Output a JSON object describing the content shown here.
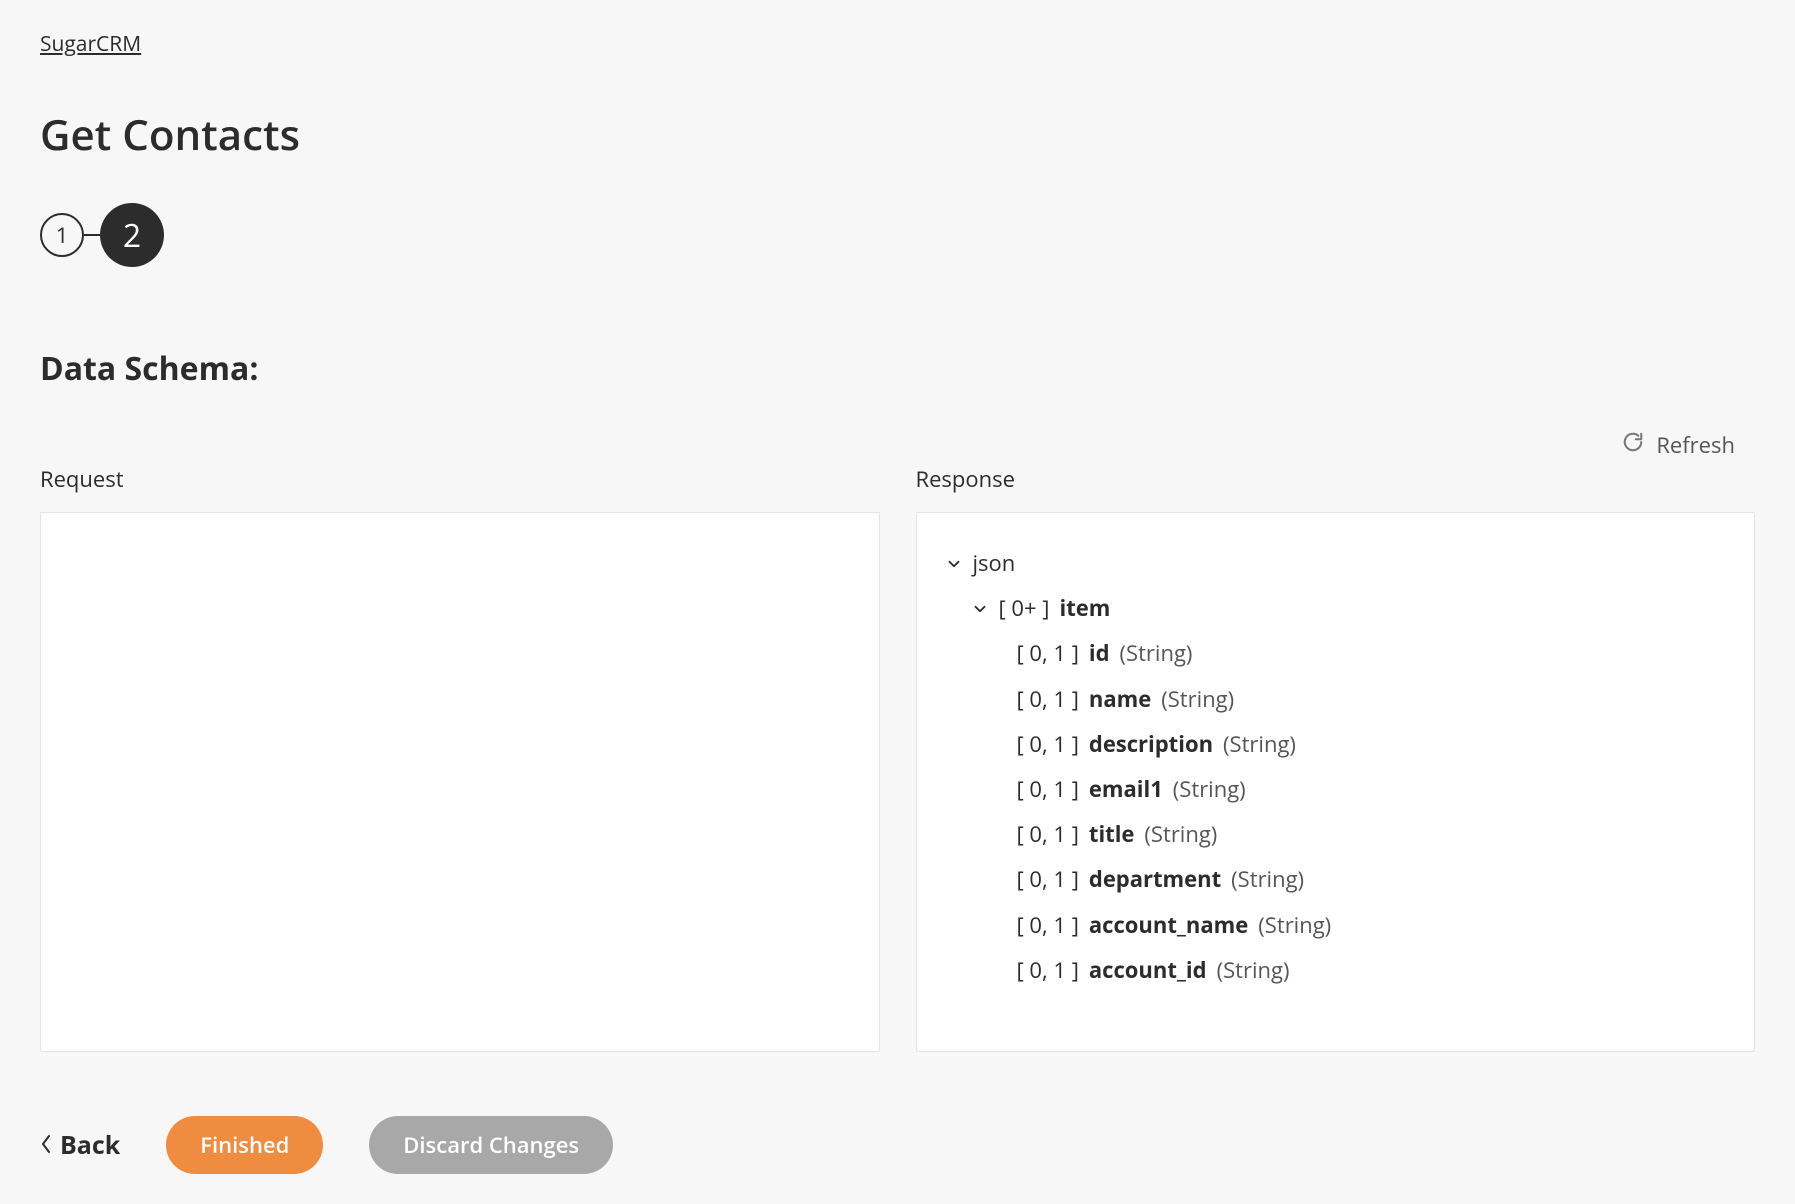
{
  "breadcrumb": "SugarCRM",
  "page_title": "Get Contacts",
  "stepper": {
    "step1": "1",
    "step2": "2"
  },
  "section_heading": "Data Schema:",
  "refresh_label": "Refresh",
  "columns": {
    "request_label": "Request",
    "response_label": "Response"
  },
  "tree": {
    "root": {
      "label": "json"
    },
    "item": {
      "cardinality": "[ 0+ ]",
      "name": "item"
    },
    "fields": [
      {
        "cardinality": "[ 0, 1 ]",
        "name": "id",
        "type": "(String)"
      },
      {
        "cardinality": "[ 0, 1 ]",
        "name": "name",
        "type": "(String)"
      },
      {
        "cardinality": "[ 0, 1 ]",
        "name": "description",
        "type": "(String)"
      },
      {
        "cardinality": "[ 0, 1 ]",
        "name": "email1",
        "type": "(String)"
      },
      {
        "cardinality": "[ 0, 1 ]",
        "name": "title",
        "type": "(String)"
      },
      {
        "cardinality": "[ 0, 1 ]",
        "name": "department",
        "type": "(String)"
      },
      {
        "cardinality": "[ 0, 1 ]",
        "name": "account_name",
        "type": "(String)"
      },
      {
        "cardinality": "[ 0, 1 ]",
        "name": "account_id",
        "type": "(String)"
      }
    ]
  },
  "footer": {
    "back": "Back",
    "finished": "Finished",
    "discard": "Discard Changes"
  }
}
